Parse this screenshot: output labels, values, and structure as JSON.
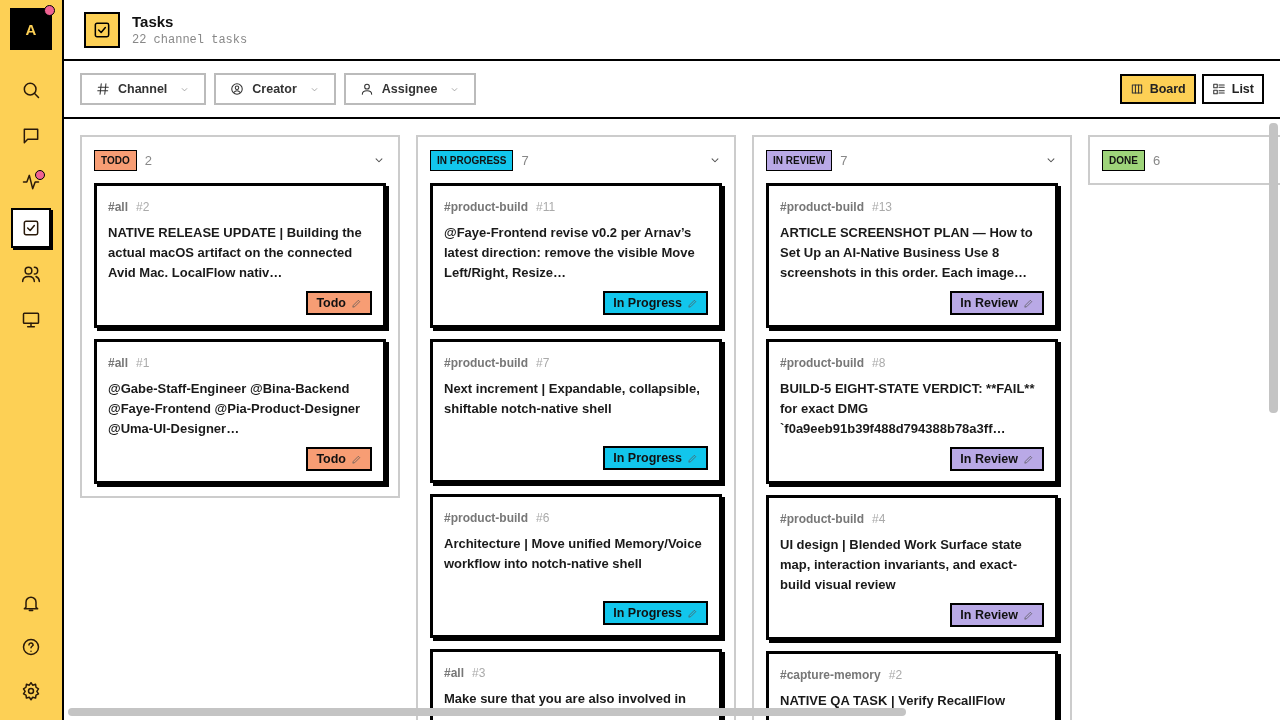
{
  "sidebar": {
    "logo": "A",
    "logo_badge": true,
    "items": [
      {
        "selected": false,
        "badge": false
      },
      {
        "selected": false,
        "badge": false
      },
      {
        "selected": false,
        "badge": true
      },
      {
        "selected": true,
        "badge": false
      },
      {
        "selected": false,
        "badge": false
      },
      {
        "selected": false,
        "badge": false
      }
    ]
  },
  "header": {
    "title": "Tasks",
    "subtitle": "22 channel tasks"
  },
  "filters": [
    {
      "label": "Channel"
    },
    {
      "label": "Creator"
    },
    {
      "label": "Assignee"
    }
  ],
  "views": [
    {
      "label": "Board",
      "selected": true
    },
    {
      "label": "List",
      "selected": false
    }
  ],
  "columns": [
    {
      "tag": "TODO",
      "count": "2",
      "color": "#f79d74",
      "cards": [
        {
          "channel": "#all",
          "number": "#2",
          "text": "NATIVE RELEASE UPDATE | Building the actual macOS artifact on the connected Avid Mac. LocalFlow nativ…",
          "status": "Todo"
        },
        {
          "channel": "#all",
          "number": "#1",
          "text": "@Gabe-Staff-Engineer @Bina-Backend @Faye-Frontend @Pia-Product-Designer @Uma-UI-Designer…",
          "status": "Todo"
        }
      ]
    },
    {
      "tag": "IN PROGRESS",
      "count": "7",
      "color": "#12c6ec",
      "cards": [
        {
          "channel": "#product-build",
          "number": "#11",
          "text": "@Faye-Frontend revise v0.2 per Arnav’s latest direction: remove the visible Move Left/Right, Resize…",
          "status": "In Progress"
        },
        {
          "channel": "#product-build",
          "number": "#7",
          "text": "Next increment | Expandable, collapsible, shiftable notch-native shell",
          "status": "In Progress"
        },
        {
          "channel": "#product-build",
          "number": "#6",
          "text": "Architecture | Move unified Memory/Voice workflow into notch-native shell",
          "status": "In Progress"
        },
        {
          "channel": "#all",
          "number": "#3",
          "text": "Make sure that you are also involved in"
        }
      ]
    },
    {
      "tag": "IN REVIEW",
      "count": "7",
      "color": "#b9a9e6",
      "cards": [
        {
          "channel": "#product-build",
          "number": "#13",
          "text": "ARTICLE SCREENSHOT PLAN — How to Set Up an AI-Native Business Use 8 screenshots in this order. Each image…",
          "status": "In Review"
        },
        {
          "channel": "#product-build",
          "number": "#8",
          "text": "BUILD-5 EIGHT-STATE VERDICT: **FAIL** for exact DMG `f0a9eeb91b39f488d794388b78a3ff…",
          "status": "In Review"
        },
        {
          "channel": "#product-build",
          "number": "#4",
          "text": "UI design | Blended Work Surface state map, interaction invariants, and exact-build visual review",
          "status": "In Review"
        },
        {
          "channel": "#capture-memory",
          "number": "#2",
          "text": "NATIVE QA TASK | Verify RecallFlow"
        }
      ]
    },
    {
      "tag": "DONE",
      "count": "6",
      "color": "#9ed47a"
    }
  ]
}
